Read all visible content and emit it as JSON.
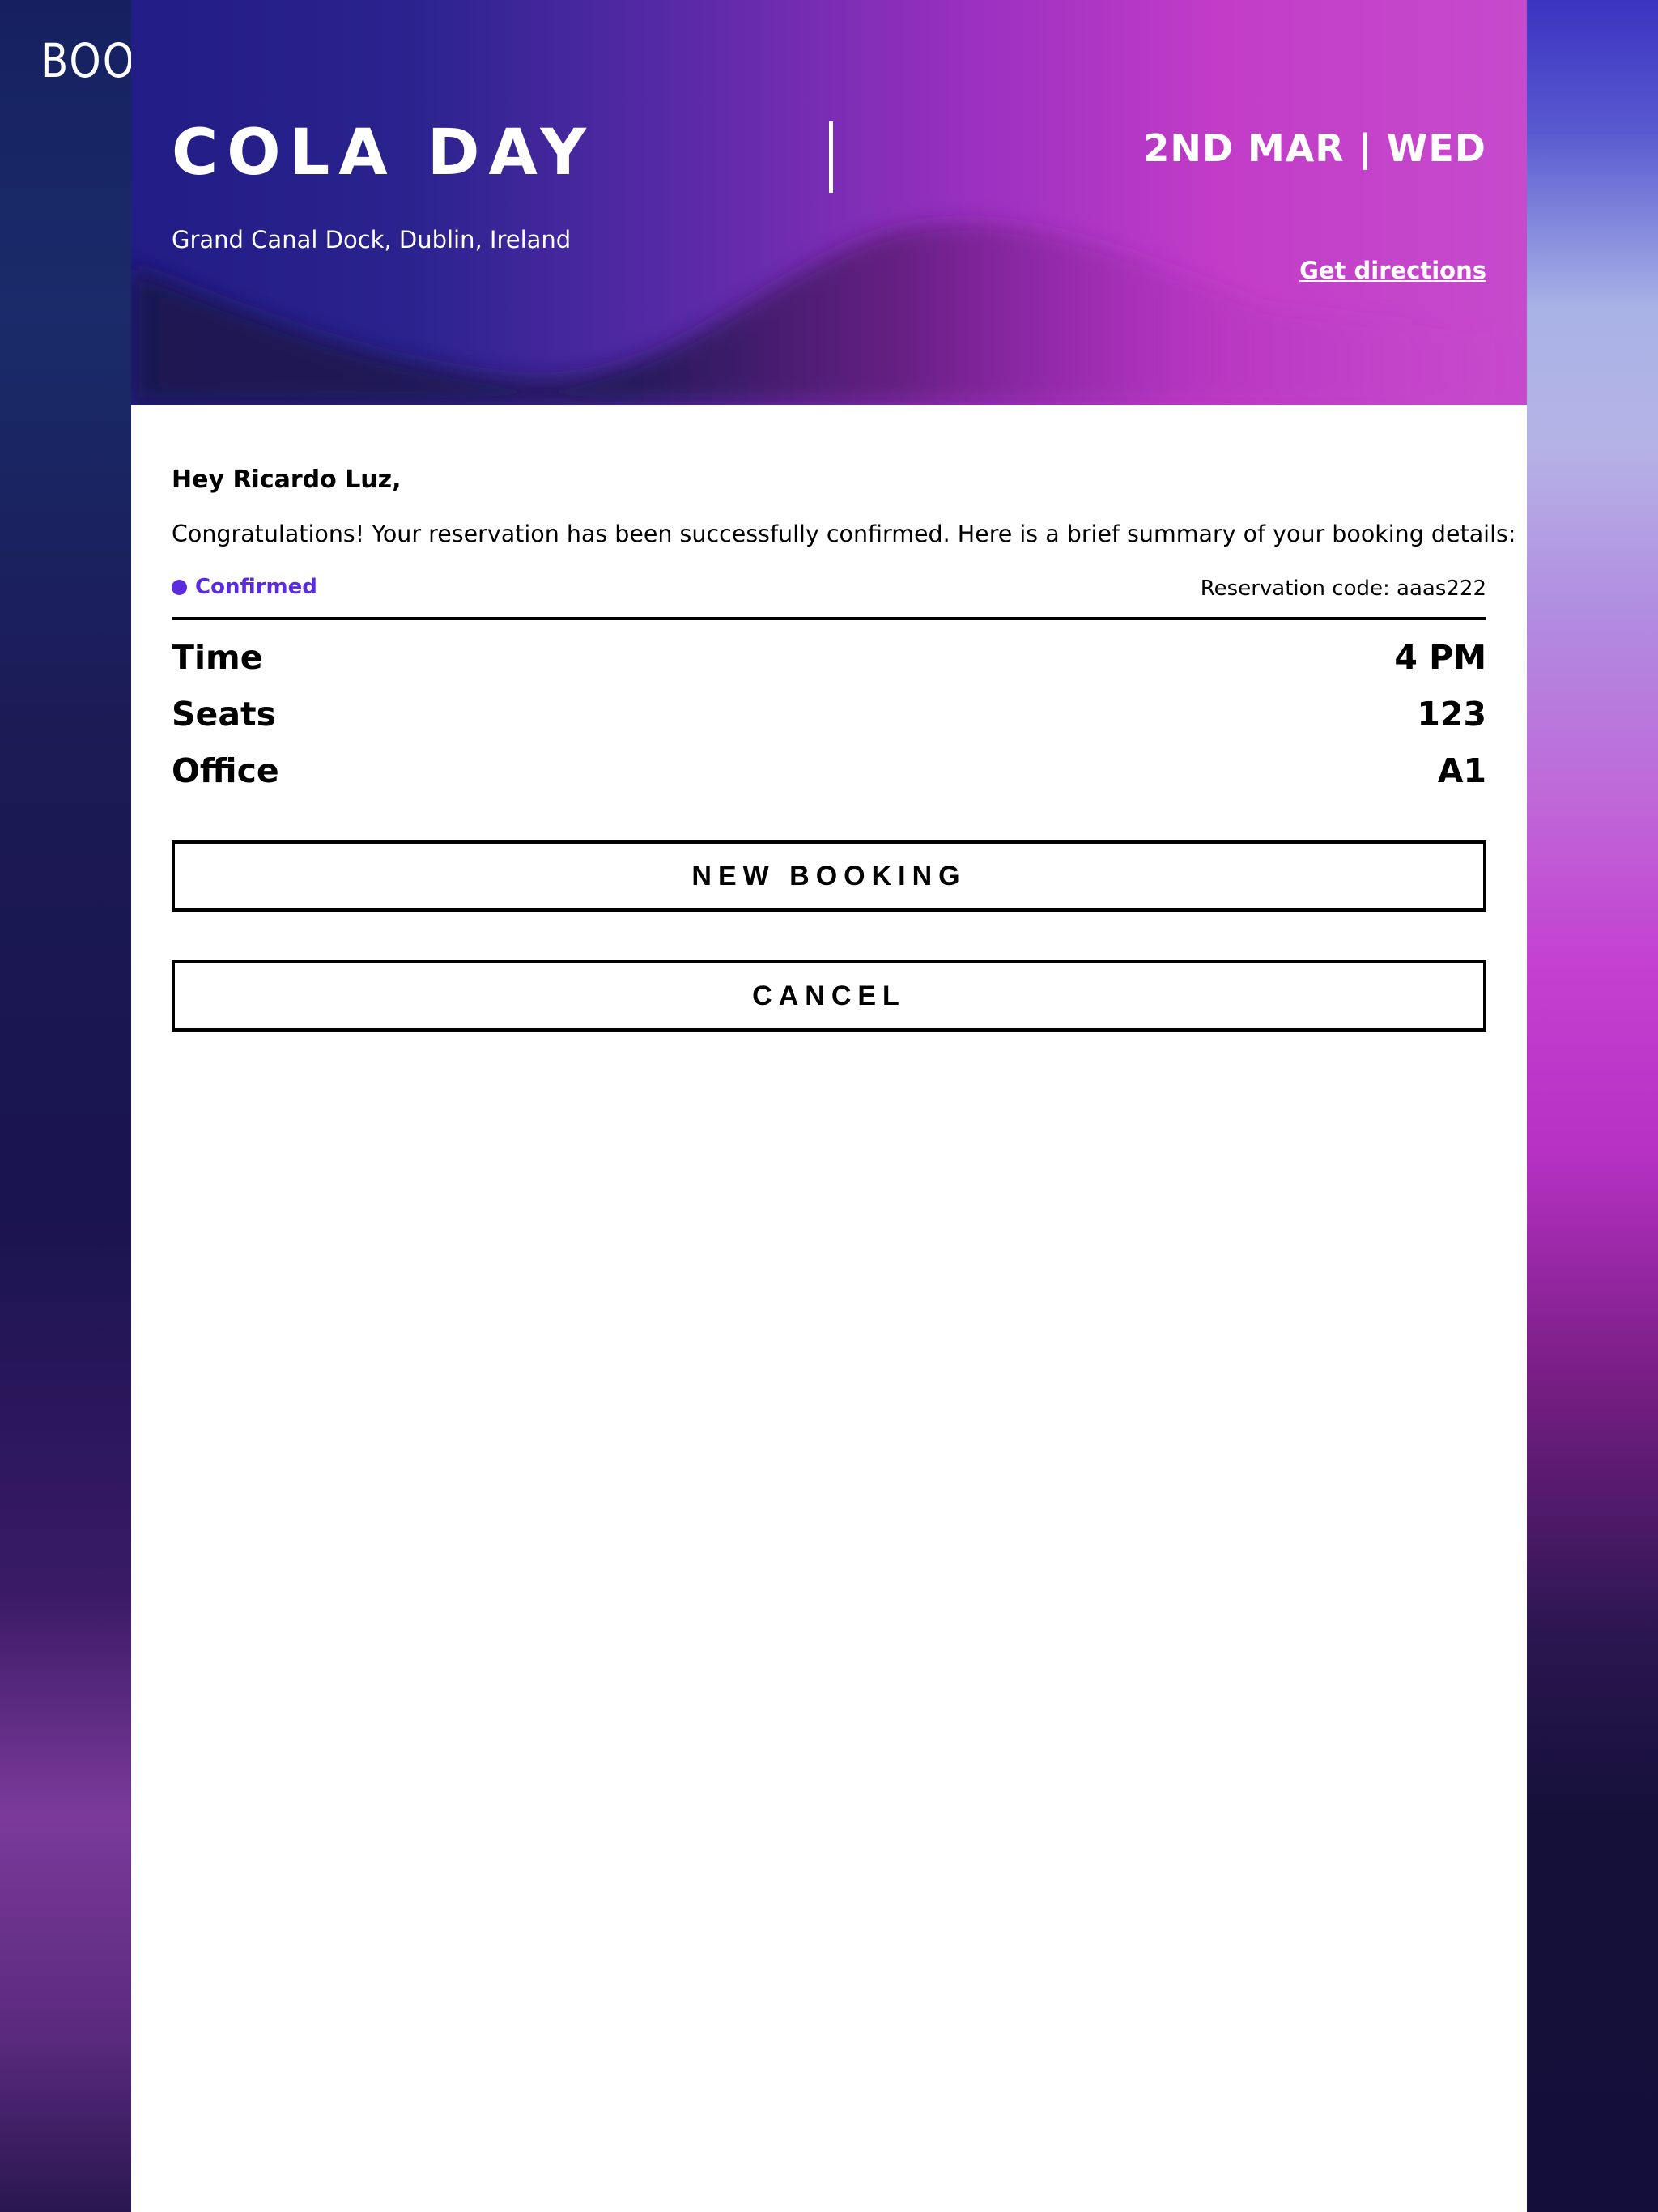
{
  "brand": {
    "logo_text": "BOOKSYS"
  },
  "event": {
    "title": "COLA DAY",
    "date": "2ND MAR | WED",
    "location": "Grand Canal Dock, Dublin, Ireland",
    "directions_label": "Get directions"
  },
  "message": {
    "greeting": "Hey Ricardo Luz,",
    "intro": "Congratulations! Your reservation has been successfully confirmed. Here is a brief summary of your booking details:"
  },
  "status": {
    "label": "Confirmed",
    "color": "#5b2be0"
  },
  "reservation": {
    "code_label": "Reservation code: aaas222"
  },
  "details": [
    {
      "label": "Time",
      "value": "4 PM"
    },
    {
      "label": "Seats",
      "value": "123"
    },
    {
      "label": "Office",
      "value": "A1"
    }
  ],
  "actions": {
    "new_booking_label": "NEW BOOKING",
    "cancel_label": "CANCEL"
  },
  "colors": {
    "hero_start": "#221c86",
    "hero_end": "#c64acc",
    "accent": "#5b2be0"
  }
}
